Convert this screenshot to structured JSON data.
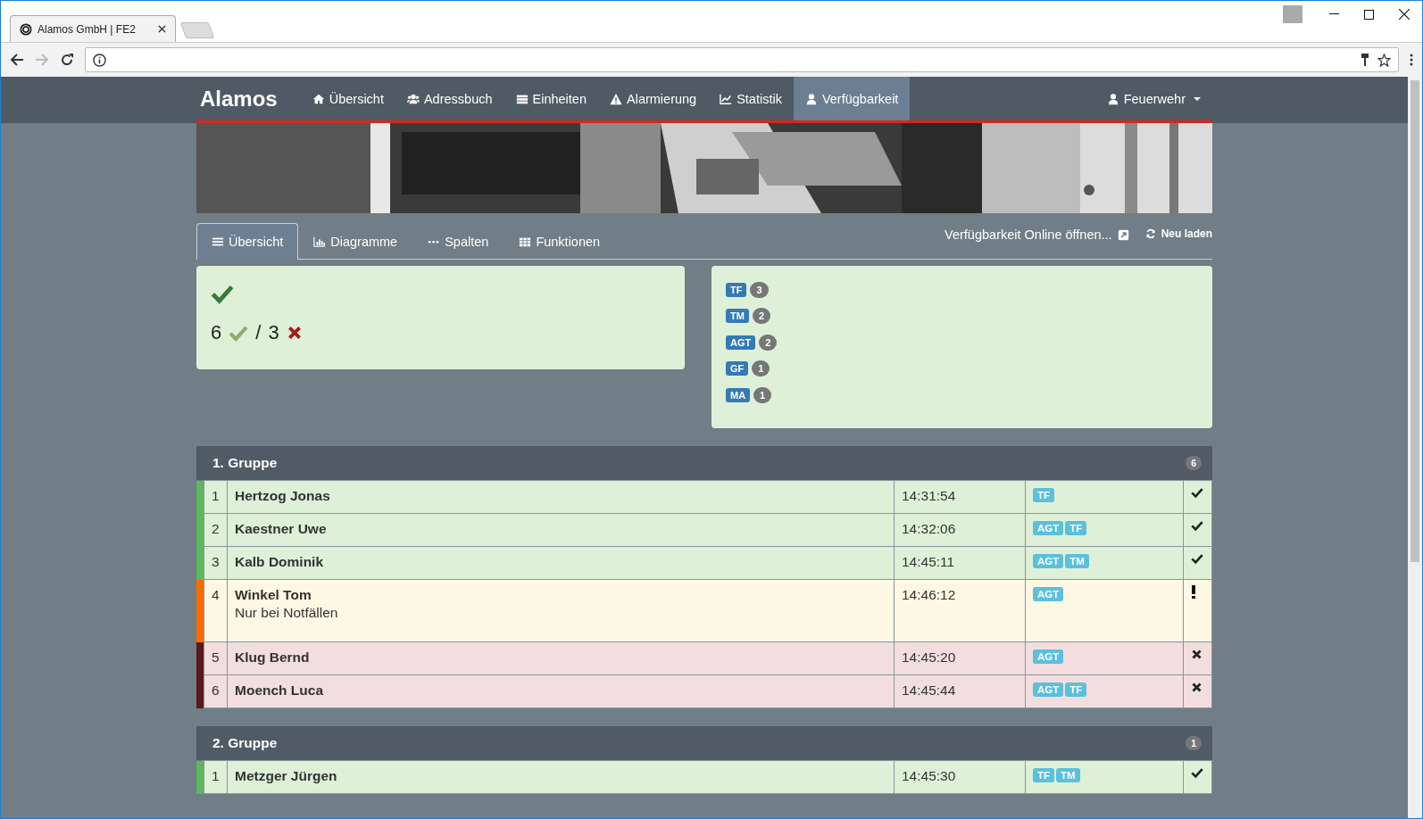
{
  "browser": {
    "tab_title": "Alamos GmbH | FE2"
  },
  "nav": {
    "brand": "Alamos",
    "items": [
      {
        "label": "Übersicht",
        "selected": false
      },
      {
        "label": "Adressbuch",
        "selected": false
      },
      {
        "label": "Einheiten",
        "selected": false
      },
      {
        "label": "Alarmierung",
        "selected": false
      },
      {
        "label": "Statistik",
        "selected": false
      },
      {
        "label": "Verfügbarkeit",
        "selected": true
      }
    ],
    "user": "Feuerwehr"
  },
  "tabs": [
    {
      "label": "Übersicht",
      "selected": true
    },
    {
      "label": "Diagramme",
      "selected": false
    },
    {
      "label": "Spalten",
      "selected": false
    },
    {
      "label": "Funktionen",
      "selected": false
    }
  ],
  "links": {
    "online": "Verfügbarkeit Online öffnen...",
    "reload": "Neu laden"
  },
  "summary": {
    "available": "6",
    "separator": "/",
    "unavailable": "3"
  },
  "functions": [
    {
      "label": "TF",
      "count": "3"
    },
    {
      "label": "TM",
      "count": "2"
    },
    {
      "label": "AGT",
      "count": "2"
    },
    {
      "label": "GF",
      "count": "1"
    },
    {
      "label": "MA",
      "count": "1"
    }
  ],
  "groups": [
    {
      "name": "1. Gruppe",
      "count": "6",
      "rows": [
        {
          "number": "1",
          "name": "Hertzog Jonas",
          "time": "14:31:54",
          "functions": [
            "TF"
          ],
          "kind": "yes"
        },
        {
          "number": "2",
          "name": "Kaestner Uwe",
          "time": "14:32:06",
          "functions": [
            "AGT",
            "TF"
          ],
          "kind": "yes"
        },
        {
          "number": "3",
          "name": "Kalb Dominik",
          "time": "14:45:11",
          "functions": [
            "AGT",
            "TM"
          ],
          "kind": "yes"
        },
        {
          "number": "4",
          "name": "Winkel Tom",
          "note": "Nur bei Notfällen",
          "time": "14:46:12",
          "functions": [
            "AGT"
          ],
          "kind": "conditional"
        },
        {
          "number": "5",
          "name": "Klug Bernd",
          "time": "14:45:20",
          "functions": [
            "AGT"
          ],
          "kind": "no"
        },
        {
          "number": "6",
          "name": "Moench Luca",
          "time": "14:45:44",
          "functions": [
            "AGT",
            "TF"
          ],
          "kind": "no"
        }
      ]
    },
    {
      "name": "2. Gruppe",
      "count": "1",
      "rows": [
        {
          "number": "1",
          "name": "Metzger Jürgen",
          "time": "14:45:30",
          "functions": [
            "TF",
            "TM"
          ],
          "kind": "yes"
        }
      ]
    }
  ]
}
